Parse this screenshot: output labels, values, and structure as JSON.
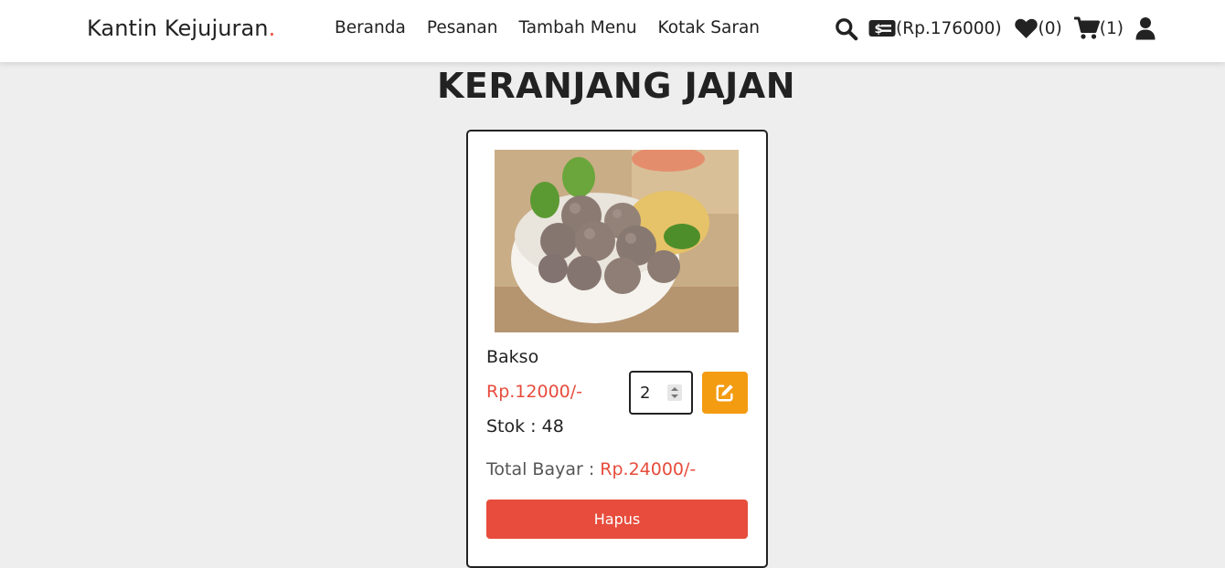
{
  "brand": {
    "name": "Kantin Kejujuran",
    "dot": "."
  },
  "nav": {
    "items": [
      {
        "label": "Beranda"
      },
      {
        "label": "Pesanan"
      },
      {
        "label": "Tambah Menu"
      },
      {
        "label": "Kotak Saran"
      }
    ]
  },
  "header_icons": {
    "balance": "(Rp.176000)",
    "wishlist_count": "(0)",
    "cart_count": "(1)",
    "icons": [
      "search-icon",
      "money-bill-icon",
      "heart-icon",
      "shopping-cart-icon",
      "user-icon"
    ]
  },
  "page": {
    "title": "KERANJANG JAJAN"
  },
  "cart": {
    "item": {
      "name": "Bakso",
      "price": "Rp.12000/-",
      "stock": "Stok : 48",
      "quantity": "2",
      "total_label": "Total Bayar : ",
      "total_amount": "Rp.24000/-",
      "delete_label": "Hapus"
    }
  },
  "colors": {
    "accent_red": "#e74c3c",
    "edit_orange": "#f39c12",
    "background": "#eeeeee"
  }
}
